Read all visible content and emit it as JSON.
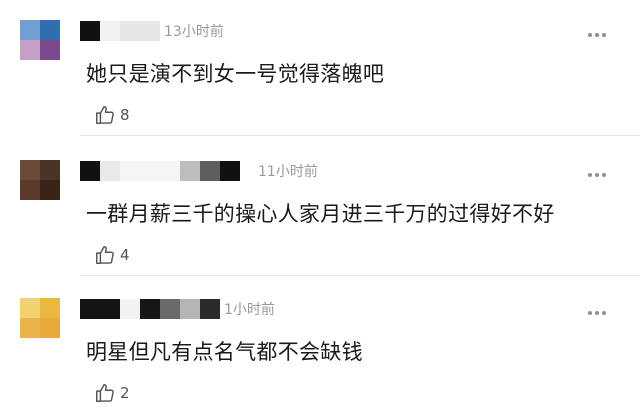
{
  "comments": [
    {
      "time": "13小时前",
      "text": "她只是演不到女一号觉得落魄吧",
      "likes": "8",
      "avatar_colors": [
        "#6f9fd0",
        "#2f6fb0",
        "#c7a0c8",
        "#7a4a8c"
      ],
      "name_blocks": [
        "#111111",
        "#f1f1f1",
        "#e6e6e6"
      ],
      "icons": {
        "like": "thumbs-up-icon",
        "more": "more-dots-icon"
      }
    },
    {
      "time": "11小时前",
      "text": "一群月薪三千的操心人家月进三千万的过得好不好",
      "likes": "4",
      "avatar_colors": [
        "#6b4a3a",
        "#4a3428",
        "#5b3a2c",
        "#3a2418"
      ],
      "name_blocks": [
        "#111111",
        "#e9e9e9",
        "#f5f5f5",
        "#bdbdbd",
        "#5e5e5e",
        "#111111"
      ],
      "icons": {
        "like": "thumbs-up-icon",
        "more": "more-dots-icon"
      }
    },
    {
      "time": "1小时前",
      "text": "明星但凡有点名气都不会缺钱",
      "likes": "2",
      "avatar_colors": [
        "#f2d170",
        "#e9b840",
        "#ebb44b",
        "#e8a83a"
      ],
      "name_blocks": [
        "#141414",
        "#f2f2f2",
        "#161616",
        "#6a6a6a",
        "#b5b5b5",
        "#2b2b2b"
      ],
      "icons": {
        "like": "thumbs-up-icon",
        "more": "more-dots-icon"
      }
    }
  ]
}
